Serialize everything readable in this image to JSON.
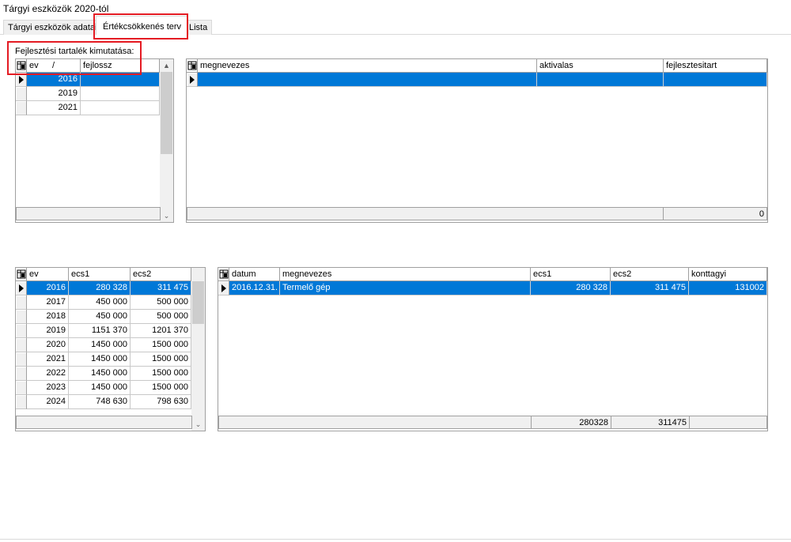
{
  "window": {
    "title": "Tárgyi eszközök 2020-tól"
  },
  "tabs": [
    {
      "label": "Tárgyi eszközök adatai"
    },
    {
      "label": "Értékcsökkenés terv"
    },
    {
      "label": "Lista"
    }
  ],
  "fejlesztesi": {
    "label": "Fejlesztési tartalék kimutatása:",
    "headers": {
      "ev": "ev",
      "sort_mark": "/",
      "fejlossz": "fejlossz"
    },
    "rows": [
      {
        "ev": "2016",
        "fejlossz": ""
      },
      {
        "ev": "2019",
        "fejlossz": ""
      },
      {
        "ev": "2021",
        "fejlossz": ""
      }
    ]
  },
  "aktivalas_grid": {
    "headers": {
      "megnevezes": "megnevezes",
      "aktivalas": "aktivalas",
      "fejlesztesitart": "fejlesztesitart"
    },
    "footer_total": "0"
  },
  "ecs_years": {
    "headers": {
      "ev": "ev",
      "ecs1": "ecs1",
      "ecs2": "ecs2"
    },
    "rows": [
      {
        "ev": "2016",
        "ecs1": "280 328",
        "ecs2": "311 475"
      },
      {
        "ev": "2017",
        "ecs1": "450 000",
        "ecs2": "500 000"
      },
      {
        "ev": "2018",
        "ecs1": "450 000",
        "ecs2": "500 000"
      },
      {
        "ev": "2019",
        "ecs1": "1151 370",
        "ecs2": "1201 370"
      },
      {
        "ev": "2020",
        "ecs1": "1450 000",
        "ecs2": "1500 000"
      },
      {
        "ev": "2021",
        "ecs1": "1450 000",
        "ecs2": "1500 000"
      },
      {
        "ev": "2022",
        "ecs1": "1450 000",
        "ecs2": "1500 000"
      },
      {
        "ev": "2023",
        "ecs1": "1450 000",
        "ecs2": "1500 000"
      },
      {
        "ev": "2024",
        "ecs1": "748 630",
        "ecs2": "798 630"
      }
    ]
  },
  "ecs_detail": {
    "headers": {
      "datum": "datum",
      "megnevezes": "megnevezes",
      "ecs1": "ecs1",
      "ecs2": "ecs2",
      "konttagyi": "konttagyi"
    },
    "rows": [
      {
        "datum": "2016.12.31.",
        "megnevezes": "Termelő gép",
        "ecs1": "280 328",
        "ecs2": "311 475",
        "konttagyi": "131002"
      }
    ],
    "footer": {
      "ecs1": "280328",
      "ecs2": "311475"
    }
  },
  "colors": {
    "selection": "#0078d7",
    "highlight_box": "#e41b23",
    "grid_line": "#a0a0a0"
  },
  "icons": {
    "column_chooser": "grid-column-icon",
    "row_pointer": "row-pointer-icon"
  }
}
